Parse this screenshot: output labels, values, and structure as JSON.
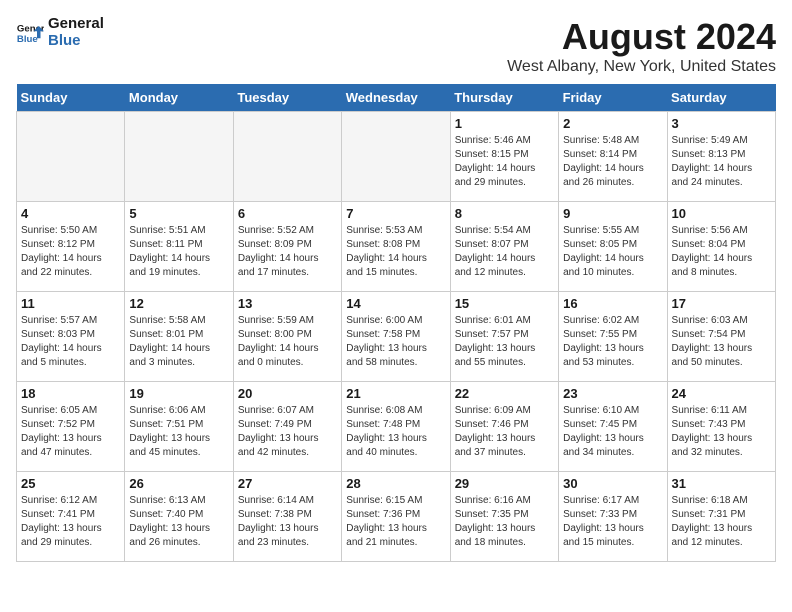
{
  "header": {
    "logo_line1": "General",
    "logo_line2": "Blue",
    "month": "August 2024",
    "location": "West Albany, New York, United States"
  },
  "weekdays": [
    "Sunday",
    "Monday",
    "Tuesday",
    "Wednesday",
    "Thursday",
    "Friday",
    "Saturday"
  ],
  "weeks": [
    [
      {
        "day": "",
        "info": ""
      },
      {
        "day": "",
        "info": ""
      },
      {
        "day": "",
        "info": ""
      },
      {
        "day": "",
        "info": ""
      },
      {
        "day": "1",
        "info": "Sunrise: 5:46 AM\nSunset: 8:15 PM\nDaylight: 14 hours\nand 29 minutes."
      },
      {
        "day": "2",
        "info": "Sunrise: 5:48 AM\nSunset: 8:14 PM\nDaylight: 14 hours\nand 26 minutes."
      },
      {
        "day": "3",
        "info": "Sunrise: 5:49 AM\nSunset: 8:13 PM\nDaylight: 14 hours\nand 24 minutes."
      }
    ],
    [
      {
        "day": "4",
        "info": "Sunrise: 5:50 AM\nSunset: 8:12 PM\nDaylight: 14 hours\nand 22 minutes."
      },
      {
        "day": "5",
        "info": "Sunrise: 5:51 AM\nSunset: 8:11 PM\nDaylight: 14 hours\nand 19 minutes."
      },
      {
        "day": "6",
        "info": "Sunrise: 5:52 AM\nSunset: 8:09 PM\nDaylight: 14 hours\nand 17 minutes."
      },
      {
        "day": "7",
        "info": "Sunrise: 5:53 AM\nSunset: 8:08 PM\nDaylight: 14 hours\nand 15 minutes."
      },
      {
        "day": "8",
        "info": "Sunrise: 5:54 AM\nSunset: 8:07 PM\nDaylight: 14 hours\nand 12 minutes."
      },
      {
        "day": "9",
        "info": "Sunrise: 5:55 AM\nSunset: 8:05 PM\nDaylight: 14 hours\nand 10 minutes."
      },
      {
        "day": "10",
        "info": "Sunrise: 5:56 AM\nSunset: 8:04 PM\nDaylight: 14 hours\nand 8 minutes."
      }
    ],
    [
      {
        "day": "11",
        "info": "Sunrise: 5:57 AM\nSunset: 8:03 PM\nDaylight: 14 hours\nand 5 minutes."
      },
      {
        "day": "12",
        "info": "Sunrise: 5:58 AM\nSunset: 8:01 PM\nDaylight: 14 hours\nand 3 minutes."
      },
      {
        "day": "13",
        "info": "Sunrise: 5:59 AM\nSunset: 8:00 PM\nDaylight: 14 hours\nand 0 minutes."
      },
      {
        "day": "14",
        "info": "Sunrise: 6:00 AM\nSunset: 7:58 PM\nDaylight: 13 hours\nand 58 minutes."
      },
      {
        "day": "15",
        "info": "Sunrise: 6:01 AM\nSunset: 7:57 PM\nDaylight: 13 hours\nand 55 minutes."
      },
      {
        "day": "16",
        "info": "Sunrise: 6:02 AM\nSunset: 7:55 PM\nDaylight: 13 hours\nand 53 minutes."
      },
      {
        "day": "17",
        "info": "Sunrise: 6:03 AM\nSunset: 7:54 PM\nDaylight: 13 hours\nand 50 minutes."
      }
    ],
    [
      {
        "day": "18",
        "info": "Sunrise: 6:05 AM\nSunset: 7:52 PM\nDaylight: 13 hours\nand 47 minutes."
      },
      {
        "day": "19",
        "info": "Sunrise: 6:06 AM\nSunset: 7:51 PM\nDaylight: 13 hours\nand 45 minutes."
      },
      {
        "day": "20",
        "info": "Sunrise: 6:07 AM\nSunset: 7:49 PM\nDaylight: 13 hours\nand 42 minutes."
      },
      {
        "day": "21",
        "info": "Sunrise: 6:08 AM\nSunset: 7:48 PM\nDaylight: 13 hours\nand 40 minutes."
      },
      {
        "day": "22",
        "info": "Sunrise: 6:09 AM\nSunset: 7:46 PM\nDaylight: 13 hours\nand 37 minutes."
      },
      {
        "day": "23",
        "info": "Sunrise: 6:10 AM\nSunset: 7:45 PM\nDaylight: 13 hours\nand 34 minutes."
      },
      {
        "day": "24",
        "info": "Sunrise: 6:11 AM\nSunset: 7:43 PM\nDaylight: 13 hours\nand 32 minutes."
      }
    ],
    [
      {
        "day": "25",
        "info": "Sunrise: 6:12 AM\nSunset: 7:41 PM\nDaylight: 13 hours\nand 29 minutes."
      },
      {
        "day": "26",
        "info": "Sunrise: 6:13 AM\nSunset: 7:40 PM\nDaylight: 13 hours\nand 26 minutes."
      },
      {
        "day": "27",
        "info": "Sunrise: 6:14 AM\nSunset: 7:38 PM\nDaylight: 13 hours\nand 23 minutes."
      },
      {
        "day": "28",
        "info": "Sunrise: 6:15 AM\nSunset: 7:36 PM\nDaylight: 13 hours\nand 21 minutes."
      },
      {
        "day": "29",
        "info": "Sunrise: 6:16 AM\nSunset: 7:35 PM\nDaylight: 13 hours\nand 18 minutes."
      },
      {
        "day": "30",
        "info": "Sunrise: 6:17 AM\nSunset: 7:33 PM\nDaylight: 13 hours\nand 15 minutes."
      },
      {
        "day": "31",
        "info": "Sunrise: 6:18 AM\nSunset: 7:31 PM\nDaylight: 13 hours\nand 12 minutes."
      }
    ]
  ]
}
